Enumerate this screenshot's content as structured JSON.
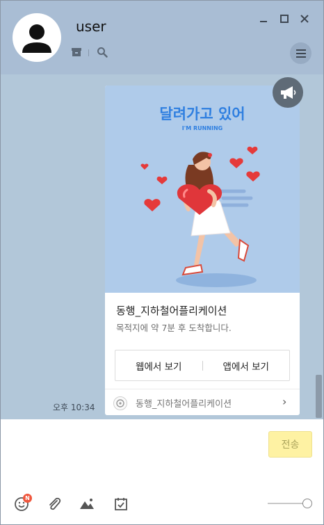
{
  "header": {
    "username": "user"
  },
  "card": {
    "image_heading": "달려가고 있어",
    "image_subheading": "I'M RUNNING",
    "title": "동행_지하철어플리케이션",
    "description": "목적지에 약 7분 후 도착합니다.",
    "button_web": "웹에서 보기",
    "button_app": "앱에서 보기",
    "footer_name": "동행_지하철어플리케이션",
    "footer_arrow": "›"
  },
  "message": {
    "time": "오후 10:34"
  },
  "input": {
    "send_label": "전송",
    "emoji_badge": "N"
  },
  "colors": {
    "header_bg": "#a9bdd4",
    "chat_bg": "#b2c7d9",
    "send_bg": "#fef2a3",
    "card_image_bg": "#afcbea",
    "heading_blue": "#2f7fe0"
  },
  "icons": [
    "person-icon",
    "archive-icon",
    "search-icon",
    "minimize-icon",
    "maximize-icon",
    "close-icon",
    "menu-icon",
    "megaphone-icon",
    "emoji-icon",
    "attach-icon",
    "image-icon",
    "calendar-icon"
  ]
}
